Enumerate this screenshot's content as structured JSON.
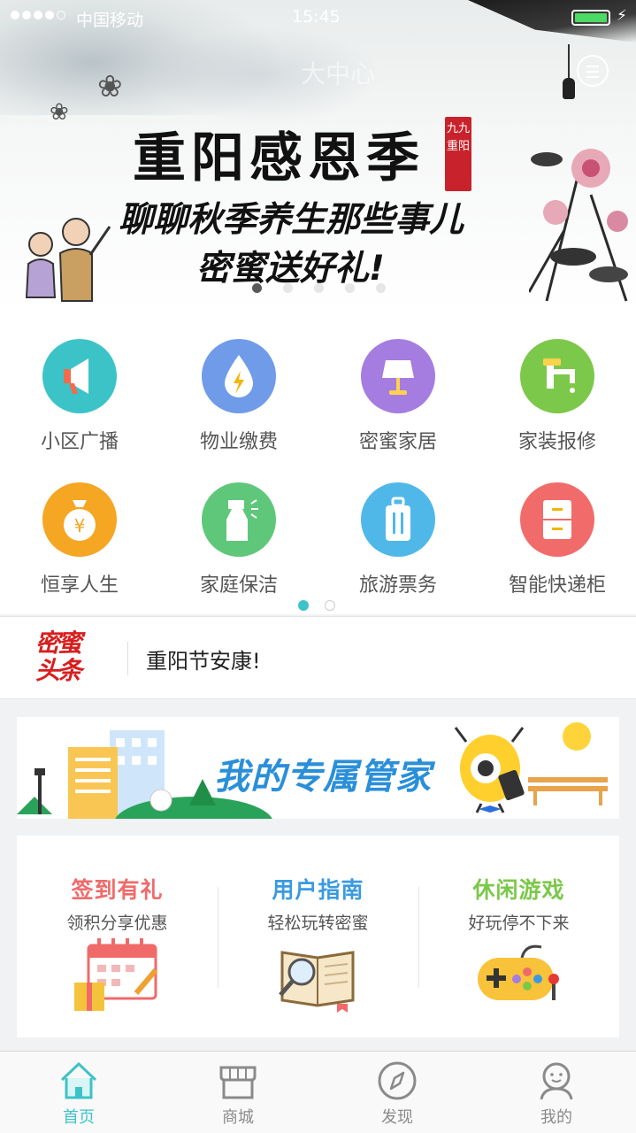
{
  "status_bar": {
    "carrier": "中国移动",
    "time": "15:45",
    "battery_level": 1.0
  },
  "header": {
    "community_name": "大中心",
    "menu_icon": "menu-circle-icon"
  },
  "banner": {
    "title": "重阳感恩季",
    "seal_text": "九九重阳",
    "line1": "聊聊秋季养生那些事儿",
    "line2": "密蜜送好礼!",
    "page_count": 5,
    "active_page": 0
  },
  "services": {
    "items": [
      {
        "label": "小区广播",
        "icon": "megaphone-icon",
        "color": "#3cc3c8"
      },
      {
        "label": "物业缴费",
        "icon": "water-drop-icon",
        "color": "#6f9be8"
      },
      {
        "label": "密蜜家居",
        "icon": "lamp-icon",
        "color": "#a57de0"
      },
      {
        "label": "家装报修",
        "icon": "faucet-icon",
        "color": "#7cc84a"
      },
      {
        "label": "恒享人生",
        "icon": "money-bag-icon",
        "color": "#f5a623"
      },
      {
        "label": "家庭保洁",
        "icon": "spray-bottle-icon",
        "color": "#5ec77a"
      },
      {
        "label": "旅游票务",
        "icon": "luggage-icon",
        "color": "#4fb8e8"
      },
      {
        "label": "智能快递柜",
        "icon": "locker-icon",
        "color": "#f26b6b"
      }
    ],
    "page_count": 2,
    "active_page": 0
  },
  "headline": {
    "logo_line1": "密蜜",
    "logo_line2": "头条",
    "text": "重阳节安康!"
  },
  "steward_banner": {
    "text": "我的专属管家"
  },
  "features": [
    {
      "title": "签到有礼",
      "subtitle": "领积分享优惠",
      "color": "#f06a6a",
      "icon": "calendar-gift-icon"
    },
    {
      "title": "用户指南",
      "subtitle": "轻松玩转密蜜",
      "color": "#3a9ae0",
      "icon": "book-magnifier-icon"
    },
    {
      "title": "休闲游戏",
      "subtitle": "好玩停不下来",
      "color": "#7cc84a",
      "icon": "gamepad-icon"
    }
  ],
  "tabbar": {
    "items": [
      {
        "label": "首页",
        "icon": "home-icon",
        "active": true
      },
      {
        "label": "商城",
        "icon": "store-icon",
        "active": false
      },
      {
        "label": "发现",
        "icon": "compass-icon",
        "active": false
      },
      {
        "label": "我的",
        "icon": "profile-icon",
        "active": false
      }
    ],
    "active_color": "#3cc3c8",
    "inactive_color": "#8a8a8a"
  }
}
